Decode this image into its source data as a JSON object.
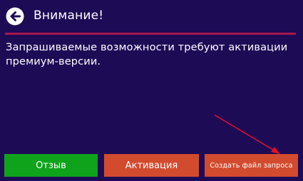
{
  "dialog": {
    "title": "Внимание!",
    "back_icon": "arrow-left-circle-icon",
    "message": "Запрашиваемые возможности требуют активации премиум-версии."
  },
  "buttons": {
    "feedback_label": "Отзыв",
    "activate_label": "Активация",
    "create_request_label": "Создать файл запроса"
  },
  "colors": {
    "background": "#1e0b56",
    "divider": "#a8174f",
    "feedback_button": "#0fa31c",
    "action_button": "#d34b2f",
    "annotation_arrow": "#e0102a"
  }
}
